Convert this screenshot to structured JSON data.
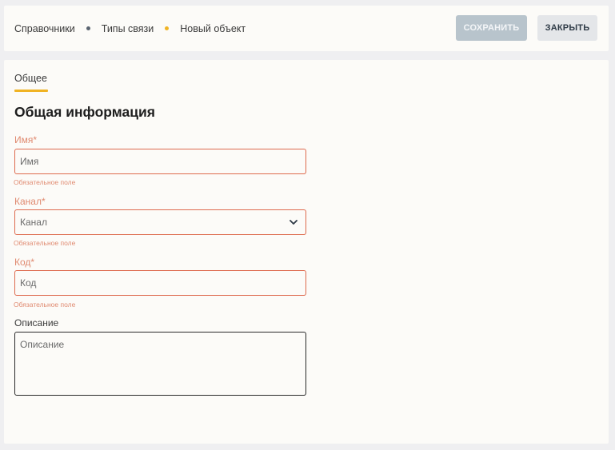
{
  "breadcrumbs": [
    {
      "label": "Справочники",
      "dot_color": "#5a6470"
    },
    {
      "label": "Типы связи",
      "dot_color": "#f0b323"
    },
    {
      "label": "Новый объект"
    }
  ],
  "toolbar": {
    "save_label": "СОХРАНИТЬ",
    "close_label": "ЗАКРЫТЬ"
  },
  "tabs": [
    {
      "label": "Общее",
      "active": true
    }
  ],
  "section_title": "Общая информация",
  "form": {
    "name": {
      "label": "Имя*",
      "placeholder": "Имя",
      "error": "Обязательное поле"
    },
    "channel": {
      "label": "Канал*",
      "placeholder": "Канал",
      "error": "Обязательное поле"
    },
    "code": {
      "label": "Код*",
      "placeholder": "Код",
      "error": "Обязательное поле"
    },
    "description": {
      "label": "Описание",
      "placeholder": "Описание"
    }
  },
  "icons": {
    "channel_dropdown": "chevron-down-icon"
  },
  "colors": {
    "accent": "#f0b323",
    "error": "#de6a4e",
    "save_disabled": "#b8c4cc"
  }
}
